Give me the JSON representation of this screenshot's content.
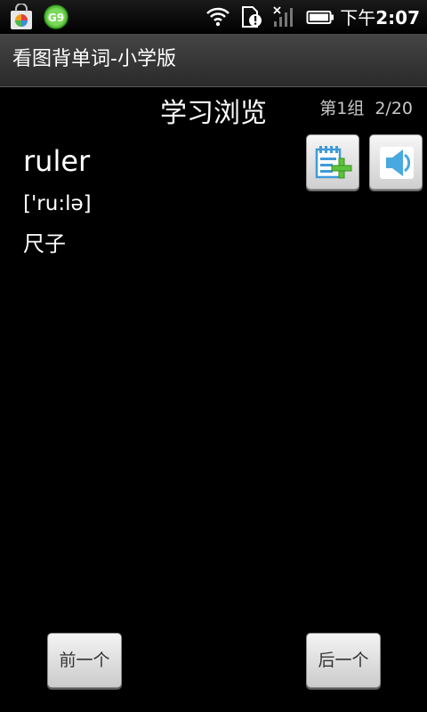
{
  "status_bar": {
    "time_period": "下午",
    "time": "2:07",
    "icons": [
      "shopping-bag-icon",
      "go-launcher-icon",
      "wifi-icon",
      "sd-card-alert-icon",
      "no-signal-icon",
      "battery-icon"
    ]
  },
  "app_bar": {
    "title": "看图背单词-小学版"
  },
  "main": {
    "heading": "学习浏览",
    "group_label": "第1组",
    "progress": "2/20",
    "word": "ruler",
    "phonetic": "['ru:lə]",
    "meaning": "尺子"
  },
  "buttons": {
    "add_icon": "add-to-wordbook-icon",
    "sound_icon": "speaker-icon",
    "prev_label": "前一个",
    "next_label": "后一个"
  },
  "colors": {
    "background": "#000000",
    "icon_blue": "#4aa8e0",
    "icon_green": "#5cc43c",
    "button_face": "#e4e4e4"
  }
}
